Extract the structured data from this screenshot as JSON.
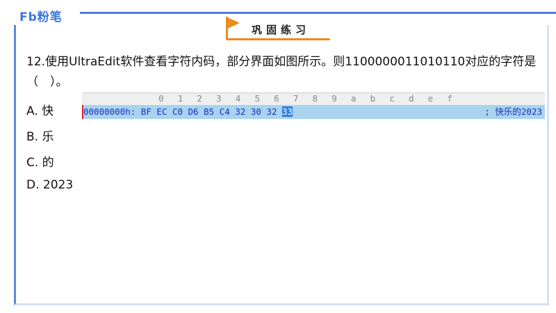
{
  "logo": "Fb粉笔",
  "banner": "巩固练习",
  "question": "12.使用UltraEdit软件查看字符内码，部分界面如图所示。则1100000011010110对应的字符是（　）。",
  "options": [
    "A. 快",
    "B. 乐",
    "C. 的",
    "D. 2023"
  ],
  "hex_view": {
    "columns": [
      "0",
      "1",
      "2",
      "3",
      "4",
      "5",
      "6",
      "7",
      "8",
      "9",
      "a",
      "b",
      "c",
      "d",
      "e",
      "f"
    ],
    "address": "00000000h:",
    "bytes": "BF EC C0 D6 B5 C4 32 30 32",
    "selected_byte": "33",
    "text": "; 快乐的2023"
  }
}
